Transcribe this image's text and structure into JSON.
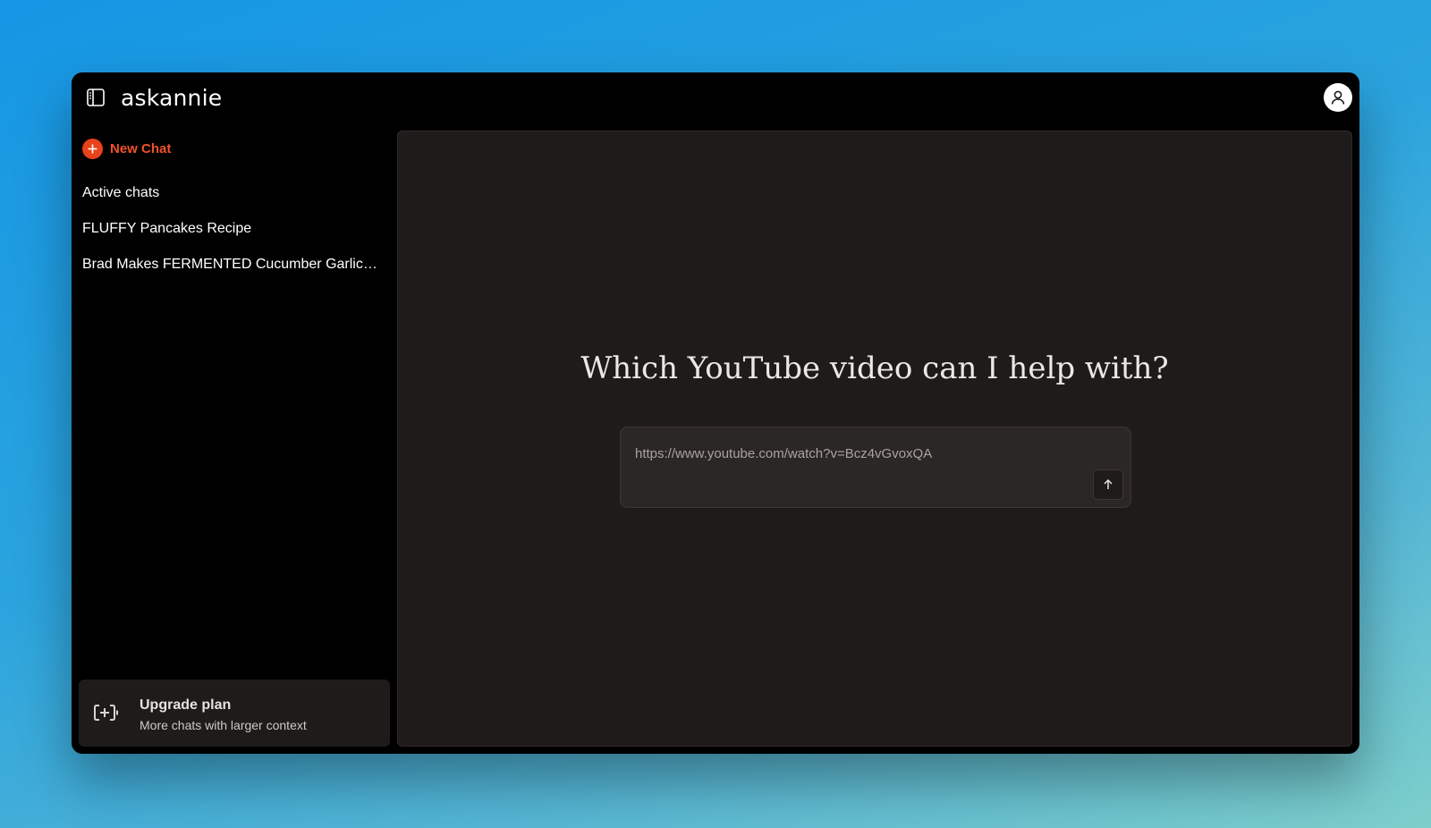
{
  "app": {
    "title": "askannie"
  },
  "sidebar": {
    "new_chat_label": "New Chat",
    "section_label": "Active chats",
    "chats": [
      {
        "label": "FLUFFY Pancakes Recipe"
      },
      {
        "label": "Brad Makes FERMENTED Cucumber Garlic Pickles"
      }
    ],
    "upgrade": {
      "title": "Upgrade plan",
      "subtitle": "More chats with larger context"
    }
  },
  "main": {
    "heading": "Which YouTube video can I help with?",
    "input": {
      "placeholder": "https://www.youtube.com/watch?v=Bcz4vGvoxQA",
      "value": ""
    }
  },
  "colors": {
    "accent": "#e8431b",
    "window_bg": "#000000",
    "panel_bg": "#1f1b1a"
  },
  "icons": {
    "sidebar_toggle": "sidebar-toggle-icon",
    "avatar": "user-icon",
    "new_chat": "plus-icon",
    "upgrade": "battery-plus-icon",
    "send": "arrow-up-icon"
  }
}
